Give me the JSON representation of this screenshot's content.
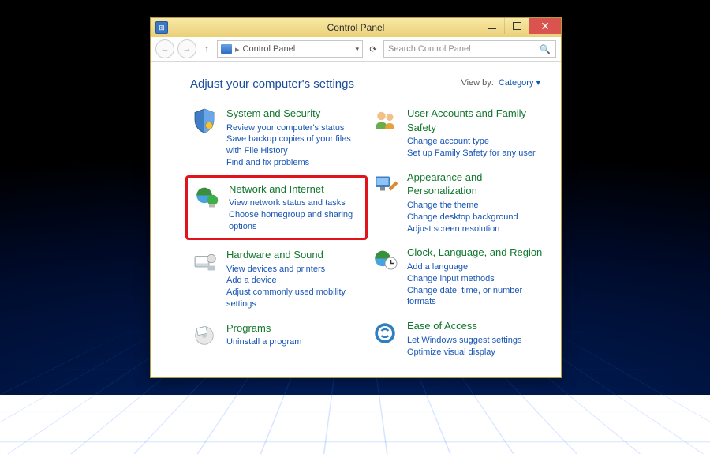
{
  "window": {
    "title": "Control Panel"
  },
  "toolbar": {
    "address_label": "Control Panel",
    "address_sep": "▸",
    "search_placeholder": "Search Control Panel"
  },
  "body": {
    "heading": "Adjust your computer's settings",
    "viewby_label": "View by:",
    "viewby_value": "Category"
  },
  "left": [
    {
      "title": "System and Security",
      "links": [
        "Review your computer's status",
        "Save backup copies of your files with File History",
        "Find and fix problems"
      ]
    },
    {
      "title": "Network and Internet",
      "links": [
        "View network status and tasks",
        "Choose homegroup and sharing options"
      ],
      "highlighted": true
    },
    {
      "title": "Hardware and Sound",
      "links": [
        "View devices and printers",
        "Add a device",
        "Adjust commonly used mobility settings"
      ]
    },
    {
      "title": "Programs",
      "links": [
        "Uninstall a program"
      ]
    }
  ],
  "right": [
    {
      "title": "User Accounts and Family Safety",
      "links": [
        "Change account type",
        "Set up Family Safety for any user"
      ]
    },
    {
      "title": "Appearance and Personalization",
      "links": [
        "Change the theme",
        "Change desktop background",
        "Adjust screen resolution"
      ]
    },
    {
      "title": "Clock, Language, and Region",
      "links": [
        "Add a language",
        "Change input methods",
        "Change date, time, or number formats"
      ]
    },
    {
      "title": "Ease of Access",
      "links": [
        "Let Windows suggest settings",
        "Optimize visual display"
      ]
    }
  ]
}
